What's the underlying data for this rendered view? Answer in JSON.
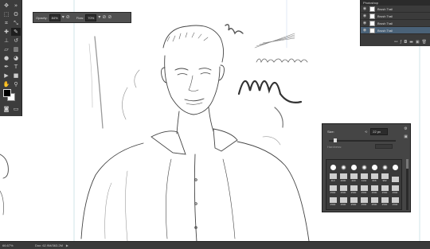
{
  "options_bar": {
    "opacity_label": "Opacity:",
    "opacity_value": "84%",
    "flow_label": "Flow:",
    "flow_value": "70%"
  },
  "layers_panel": {
    "header": "Photoshop",
    "layers": [
      {
        "name": "Brush Trail",
        "selected": false
      },
      {
        "name": "Brush Trail",
        "selected": false
      },
      {
        "name": "Brush Trail",
        "selected": false
      },
      {
        "name": "Brush Trail",
        "selected": true
      }
    ]
  },
  "brush_panel": {
    "size_label": "Size:",
    "size_value": "22 px",
    "hardness_label": "Hardness:",
    "tips_row1": [
      "",
      "",
      "",
      "",
      "",
      "",
      ""
    ],
    "tips_row2": [
      "110",
      "2000",
      "200",
      "1141",
      "666",
      "982",
      ""
    ],
    "tips_row3": [
      "2500",
      "2500",
      "2500",
      "2500",
      "2500",
      "2500",
      "2500"
    ],
    "tips_row4": [
      "2500",
      "2500",
      "2500",
      "2500",
      "2500",
      "2500",
      "2500"
    ]
  },
  "status_bar": {
    "zoom": "66.67%",
    "doc": "Doc: 62.9M/363.2M"
  },
  "colors": {
    "ui_dark": "#3c3c3c",
    "panel": "#454545",
    "selected_layer": "#4a6278",
    "foreground": "#000000",
    "background": "#ffffff"
  }
}
